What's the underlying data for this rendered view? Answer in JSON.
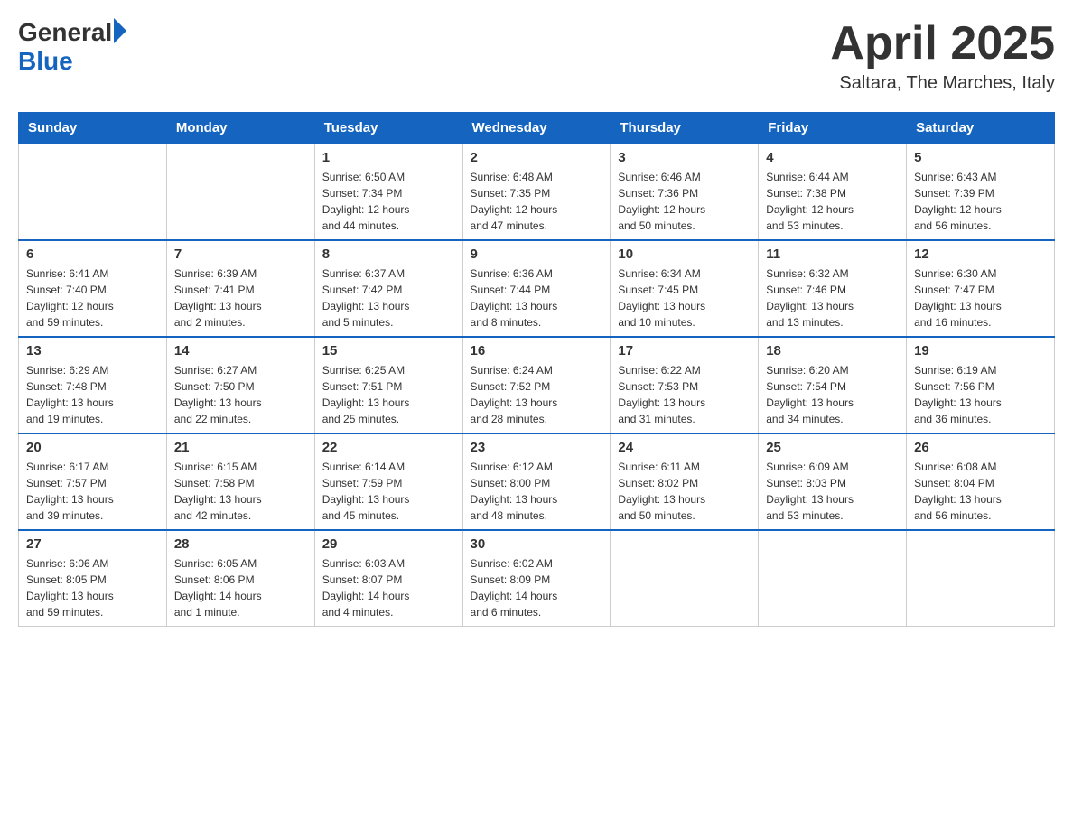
{
  "logo": {
    "general": "General",
    "blue": "Blue"
  },
  "title": "April 2025",
  "subtitle": "Saltara, The Marches, Italy",
  "days_header": [
    "Sunday",
    "Monday",
    "Tuesday",
    "Wednesday",
    "Thursday",
    "Friday",
    "Saturday"
  ],
  "weeks": [
    [
      {
        "day": "",
        "info": ""
      },
      {
        "day": "",
        "info": ""
      },
      {
        "day": "1",
        "info": "Sunrise: 6:50 AM\nSunset: 7:34 PM\nDaylight: 12 hours\nand 44 minutes."
      },
      {
        "day": "2",
        "info": "Sunrise: 6:48 AM\nSunset: 7:35 PM\nDaylight: 12 hours\nand 47 minutes."
      },
      {
        "day": "3",
        "info": "Sunrise: 6:46 AM\nSunset: 7:36 PM\nDaylight: 12 hours\nand 50 minutes."
      },
      {
        "day": "4",
        "info": "Sunrise: 6:44 AM\nSunset: 7:38 PM\nDaylight: 12 hours\nand 53 minutes."
      },
      {
        "day": "5",
        "info": "Sunrise: 6:43 AM\nSunset: 7:39 PM\nDaylight: 12 hours\nand 56 minutes."
      }
    ],
    [
      {
        "day": "6",
        "info": "Sunrise: 6:41 AM\nSunset: 7:40 PM\nDaylight: 12 hours\nand 59 minutes."
      },
      {
        "day": "7",
        "info": "Sunrise: 6:39 AM\nSunset: 7:41 PM\nDaylight: 13 hours\nand 2 minutes."
      },
      {
        "day": "8",
        "info": "Sunrise: 6:37 AM\nSunset: 7:42 PM\nDaylight: 13 hours\nand 5 minutes."
      },
      {
        "day": "9",
        "info": "Sunrise: 6:36 AM\nSunset: 7:44 PM\nDaylight: 13 hours\nand 8 minutes."
      },
      {
        "day": "10",
        "info": "Sunrise: 6:34 AM\nSunset: 7:45 PM\nDaylight: 13 hours\nand 10 minutes."
      },
      {
        "day": "11",
        "info": "Sunrise: 6:32 AM\nSunset: 7:46 PM\nDaylight: 13 hours\nand 13 minutes."
      },
      {
        "day": "12",
        "info": "Sunrise: 6:30 AM\nSunset: 7:47 PM\nDaylight: 13 hours\nand 16 minutes."
      }
    ],
    [
      {
        "day": "13",
        "info": "Sunrise: 6:29 AM\nSunset: 7:48 PM\nDaylight: 13 hours\nand 19 minutes."
      },
      {
        "day": "14",
        "info": "Sunrise: 6:27 AM\nSunset: 7:50 PM\nDaylight: 13 hours\nand 22 minutes."
      },
      {
        "day": "15",
        "info": "Sunrise: 6:25 AM\nSunset: 7:51 PM\nDaylight: 13 hours\nand 25 minutes."
      },
      {
        "day": "16",
        "info": "Sunrise: 6:24 AM\nSunset: 7:52 PM\nDaylight: 13 hours\nand 28 minutes."
      },
      {
        "day": "17",
        "info": "Sunrise: 6:22 AM\nSunset: 7:53 PM\nDaylight: 13 hours\nand 31 minutes."
      },
      {
        "day": "18",
        "info": "Sunrise: 6:20 AM\nSunset: 7:54 PM\nDaylight: 13 hours\nand 34 minutes."
      },
      {
        "day": "19",
        "info": "Sunrise: 6:19 AM\nSunset: 7:56 PM\nDaylight: 13 hours\nand 36 minutes."
      }
    ],
    [
      {
        "day": "20",
        "info": "Sunrise: 6:17 AM\nSunset: 7:57 PM\nDaylight: 13 hours\nand 39 minutes."
      },
      {
        "day": "21",
        "info": "Sunrise: 6:15 AM\nSunset: 7:58 PM\nDaylight: 13 hours\nand 42 minutes."
      },
      {
        "day": "22",
        "info": "Sunrise: 6:14 AM\nSunset: 7:59 PM\nDaylight: 13 hours\nand 45 minutes."
      },
      {
        "day": "23",
        "info": "Sunrise: 6:12 AM\nSunset: 8:00 PM\nDaylight: 13 hours\nand 48 minutes."
      },
      {
        "day": "24",
        "info": "Sunrise: 6:11 AM\nSunset: 8:02 PM\nDaylight: 13 hours\nand 50 minutes."
      },
      {
        "day": "25",
        "info": "Sunrise: 6:09 AM\nSunset: 8:03 PM\nDaylight: 13 hours\nand 53 minutes."
      },
      {
        "day": "26",
        "info": "Sunrise: 6:08 AM\nSunset: 8:04 PM\nDaylight: 13 hours\nand 56 minutes."
      }
    ],
    [
      {
        "day": "27",
        "info": "Sunrise: 6:06 AM\nSunset: 8:05 PM\nDaylight: 13 hours\nand 59 minutes."
      },
      {
        "day": "28",
        "info": "Sunrise: 6:05 AM\nSunset: 8:06 PM\nDaylight: 14 hours\nand 1 minute."
      },
      {
        "day": "29",
        "info": "Sunrise: 6:03 AM\nSunset: 8:07 PM\nDaylight: 14 hours\nand 4 minutes."
      },
      {
        "day": "30",
        "info": "Sunrise: 6:02 AM\nSunset: 8:09 PM\nDaylight: 14 hours\nand 6 minutes."
      },
      {
        "day": "",
        "info": ""
      },
      {
        "day": "",
        "info": ""
      },
      {
        "day": "",
        "info": ""
      }
    ]
  ]
}
